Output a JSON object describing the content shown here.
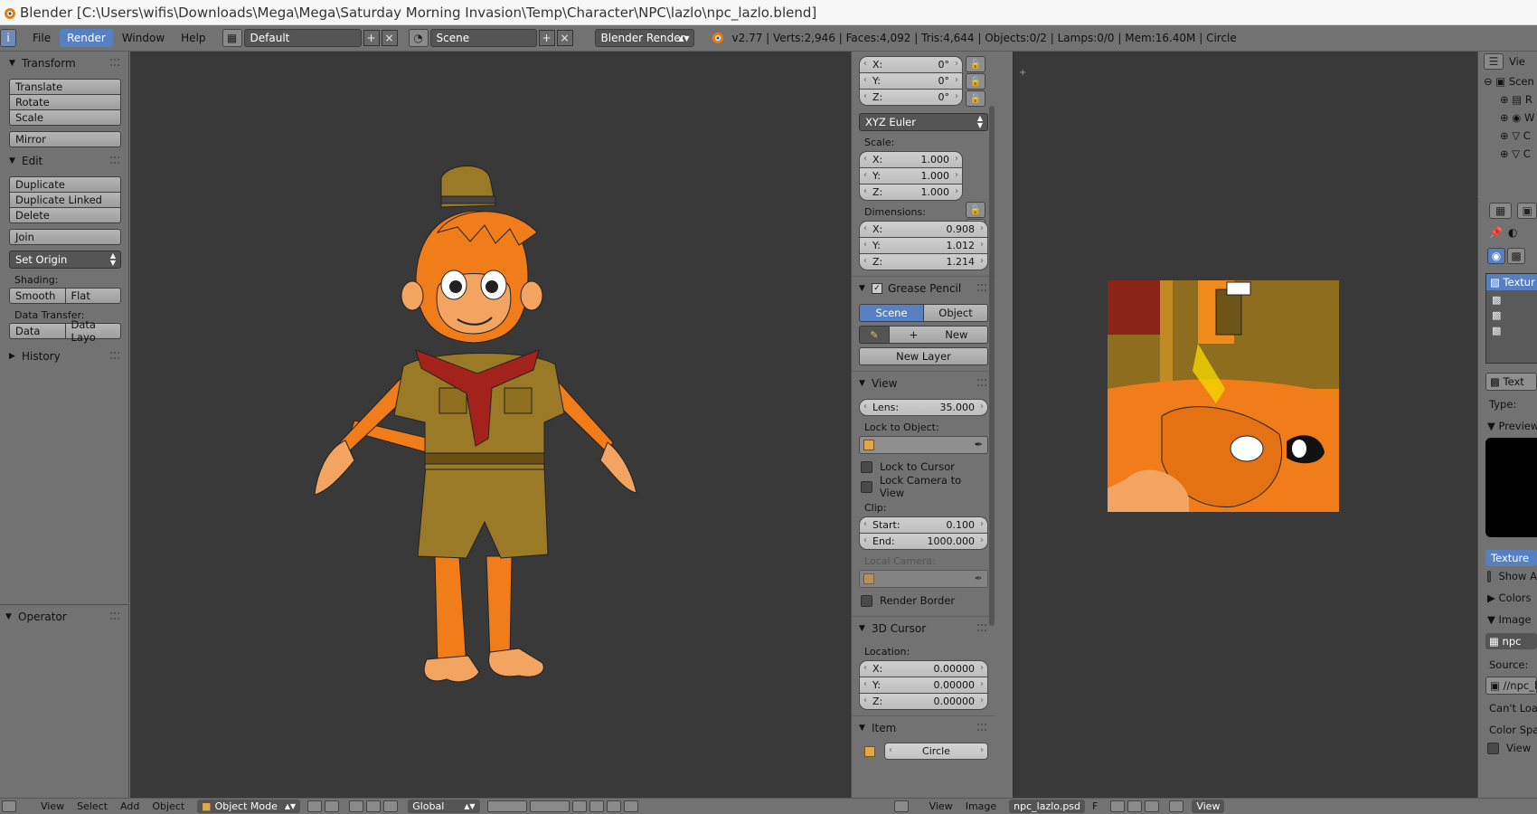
{
  "window": {
    "title": "Blender [C:\\Users\\wifis\\Downloads\\Mega\\Mega\\Saturday Morning Invasion\\Temp\\Character\\NPC\\lazlo\\npc_lazlo.blend]"
  },
  "menubar": {
    "items": [
      "File",
      "Render",
      "Window",
      "Help"
    ],
    "active": "Render",
    "layout": "Default",
    "scene": "Scene",
    "engine": "Blender Render",
    "stats": "v2.77 | Verts:2,946 | Faces:4,092 | Tris:4,644 | Objects:0/2 | Lamps:0/0 | Mem:16.40M | Circle"
  },
  "toolshelf": {
    "transform": {
      "header": "Transform",
      "buttons": [
        "Translate",
        "Rotate",
        "Scale"
      ],
      "mirror": "Mirror"
    },
    "edit": {
      "header": "Edit",
      "buttons": [
        "Duplicate",
        "Duplicate Linked",
        "Delete"
      ],
      "join": "Join",
      "set_origin": "Set Origin",
      "shading_label": "Shading:",
      "smooth": "Smooth",
      "flat": "Flat",
      "data_transfer_label": "Data Transfer:",
      "data": "Data",
      "data_layout": "Data Layo"
    },
    "history": "History",
    "operator": "Operator"
  },
  "npanel": {
    "rotation": [
      {
        "axis": "X:",
        "value": "0°"
      },
      {
        "axis": "Y:",
        "value": "0°"
      },
      {
        "axis": "Z:",
        "value": "0°"
      }
    ],
    "rotation_mode": "XYZ Euler",
    "scale_label": "Scale:",
    "scale": [
      {
        "axis": "X:",
        "value": "1.000"
      },
      {
        "axis": "Y:",
        "value": "1.000"
      },
      {
        "axis": "Z:",
        "value": "1.000"
      }
    ],
    "dimensions_label": "Dimensions:",
    "dimensions": [
      {
        "axis": "X:",
        "value": "0.908"
      },
      {
        "axis": "Y:",
        "value": "1.012"
      },
      {
        "axis": "Z:",
        "value": "1.214"
      }
    ],
    "grease_pencil": {
      "header": "Grease Pencil",
      "scene": "Scene",
      "object": "Object",
      "new": "New",
      "new_layer": "New Layer"
    },
    "view": {
      "header": "View",
      "lens_label": "Lens:",
      "lens_value": "35.000",
      "lock_to_object": "Lock to Object:",
      "lock_to_cursor": "Lock to Cursor",
      "lock_camera": "Lock Camera to View",
      "clip_label": "Clip:",
      "start_label": "Start:",
      "start_value": "0.100",
      "end_label": "End:",
      "end_value": "1000.000",
      "local_camera": "Local Camera:",
      "render_border": "Render Border"
    },
    "cursor": {
      "header": "3D Cursor",
      "location_label": "Location:",
      "location": [
        {
          "axis": "X:",
          "value": "0.00000"
        },
        {
          "axis": "Y:",
          "value": "0.00000"
        },
        {
          "axis": "Z:",
          "value": "0.00000"
        }
      ]
    },
    "item": {
      "header": "Item",
      "name": "Circle"
    }
  },
  "outliner": {
    "view": "Vie",
    "scene": "Scen",
    "rows": [
      "R",
      "W",
      "C",
      "C"
    ]
  },
  "properties": {
    "texture_slot": "Textur",
    "texture_field": "Text",
    "type_label": "Type:",
    "preview": "Preview",
    "texture_tab": "Texture",
    "show_alpha": "Show A",
    "colors": "Colors",
    "image": "Image",
    "image_field": "npc",
    "source_label": "Source:",
    "filepath": "//npc_l",
    "cant_load": "Can't Loa",
    "color_space": "Color Spac",
    "view_as": "View"
  },
  "bottombar": {
    "view": "View",
    "select": "Select",
    "add": "Add",
    "object": "Object",
    "mode": "Object Mode",
    "orientation": "Global",
    "img_view": "View",
    "img_image": "Image",
    "img_name": "npc_lazlo.psd",
    "img_f": "F",
    "img_view2": "View"
  },
  "colors": {
    "accent": "#5680c2",
    "panel": "#727272",
    "viewport": "#393939"
  }
}
